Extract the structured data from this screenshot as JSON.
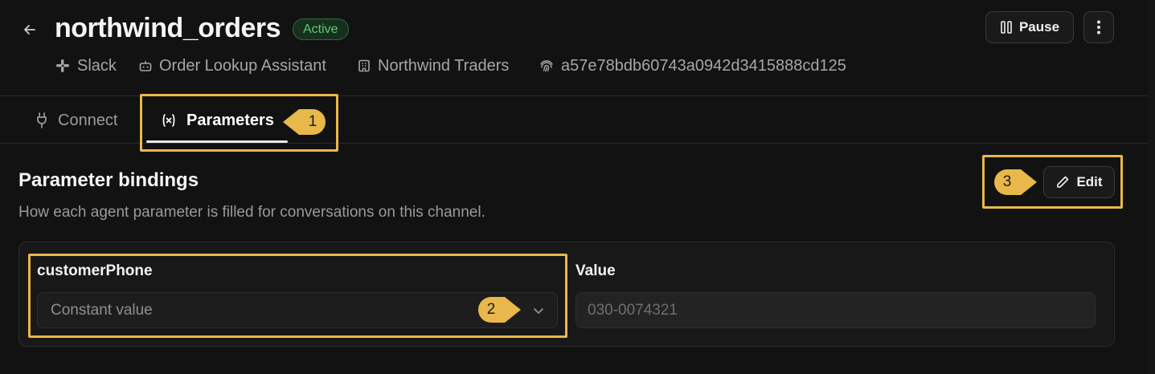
{
  "header": {
    "title": "northwind_orders",
    "status": "Active",
    "meta": {
      "platform": "Slack",
      "agent": "Order Lookup Assistant",
      "organization": "Northwind Traders",
      "id": "a57e78bdb60743a0942d3415888cd125"
    },
    "pause_label": "Pause"
  },
  "tabs": [
    {
      "label": "Connect",
      "active": false
    },
    {
      "label": "Parameters",
      "active": true
    }
  ],
  "section": {
    "title": "Parameter bindings",
    "description": "How each agent parameter is filled for conversations on this channel.",
    "edit_label": "Edit"
  },
  "binding": {
    "parameter": "customerPhone",
    "mode_value": "Constant value",
    "value_label": "Value",
    "value_placeholder": "030-0074321"
  },
  "annotations": [
    {
      "number": "1",
      "target": "Parameters tab"
    },
    {
      "number": "2",
      "target": "binding mode select"
    },
    {
      "number": "3",
      "target": "Edit button"
    }
  ],
  "colors": {
    "background": "#121212",
    "annotation": "#e8b84a",
    "badge_green": "#5ccb74"
  }
}
